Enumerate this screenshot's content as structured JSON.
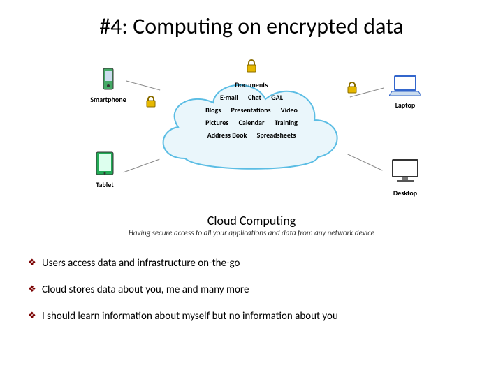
{
  "title": "#4: Computing on encrypted data",
  "cloud": {
    "items": [
      "Documents",
      "E-mail",
      "Chat",
      "GAL",
      "Blogs",
      "Presentations",
      "Video",
      "Pictures",
      "Calendar",
      "Training",
      "Address Book",
      "Spreadsheets"
    ]
  },
  "devices": {
    "smartphone": "Smartphone",
    "tablet": "Tablet",
    "laptop": "Laptop",
    "desktop": "Desktop"
  },
  "cc_title": "Cloud Computing",
  "cc_sub": "Having secure access to all your applications and data from any network device",
  "bullets": [
    "Users access data and infrastructure on-the-go",
    "Cloud stores data about you, me and many more",
    "I should learn information about myself but no information about you"
  ]
}
